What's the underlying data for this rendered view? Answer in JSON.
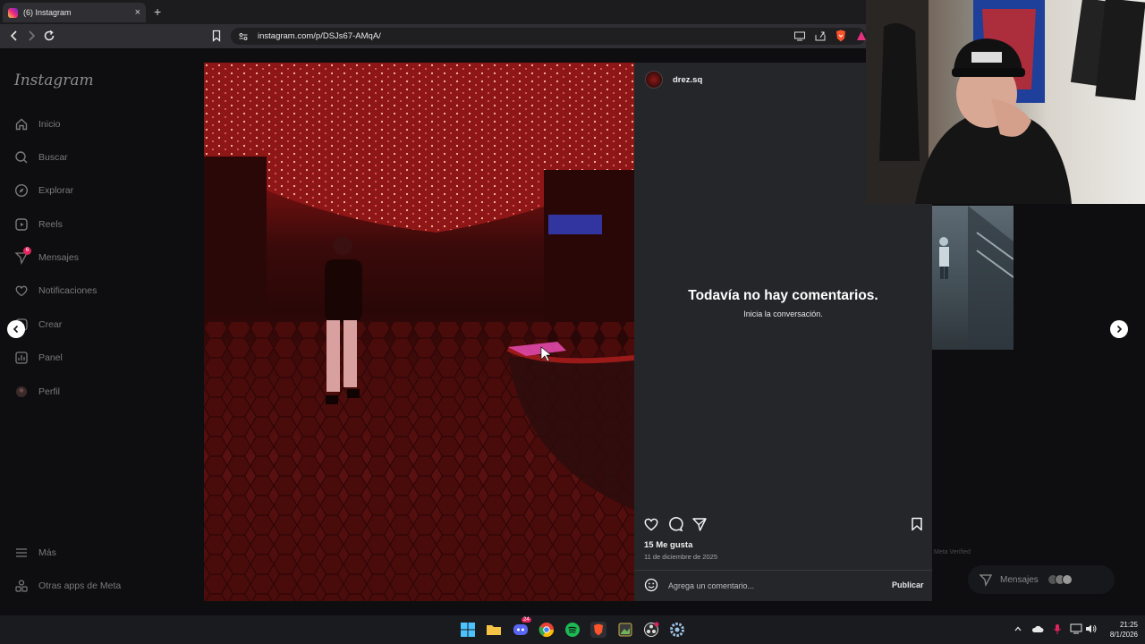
{
  "browser": {
    "tab_title": "(6) Instagram",
    "tab_close": "×",
    "new_tab": "+",
    "url": "instagram.com/p/DSJs67-AMqA/"
  },
  "sidebar": {
    "logo": "Instagram",
    "items": [
      {
        "label": "Inicio",
        "icon": "home-icon"
      },
      {
        "label": "Buscar",
        "icon": "search-icon"
      },
      {
        "label": "Explorar",
        "icon": "compass-icon"
      },
      {
        "label": "Reels",
        "icon": "reels-icon"
      },
      {
        "label": "Mensajes",
        "icon": "messenger-icon",
        "badge": "6"
      },
      {
        "label": "Notificaciones",
        "icon": "heart-icon"
      },
      {
        "label": "Crear",
        "icon": "plus-icon"
      },
      {
        "label": "Panel",
        "icon": "chart-icon"
      },
      {
        "label": "Perfil",
        "icon": "profile-icon"
      }
    ],
    "more": "Más",
    "meta_apps": "Otras apps de Meta"
  },
  "post": {
    "author": "drez.sq",
    "no_comments_title": "Todavía no hay comentarios.",
    "no_comments_subtitle": "Inicia la conversación.",
    "likes": "15 Me gusta",
    "date": "11 de diciembre de 2025",
    "comment_placeholder": "Agrega un comentario...",
    "publish": "Publicar"
  },
  "right_rail": {
    "meta_verified": "Meta Verified",
    "messages_label": "Mensajes"
  },
  "taskbar": {
    "time": "21:25",
    "date": "8/1/2026",
    "discord_badge": "24"
  },
  "colors": {
    "page_bg": "#0e0e10",
    "panel_bg": "#25262a",
    "sidebar_text": "#7a7a7a",
    "badge": "#e0245e"
  }
}
